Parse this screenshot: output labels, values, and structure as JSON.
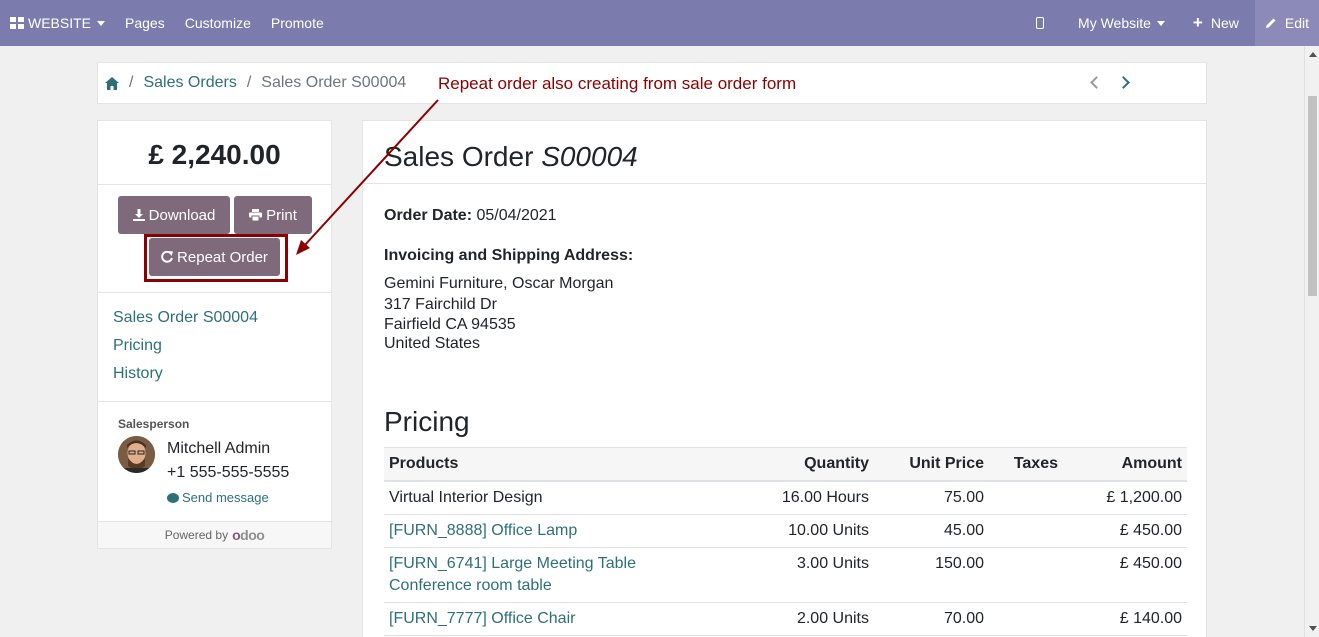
{
  "topbar": {
    "brand": "WEBSITE",
    "menu": [
      "Pages",
      "Customize",
      "Promote"
    ],
    "website": "My Website",
    "new_label": "New",
    "edit_label": "Edit"
  },
  "breadcrumb": {
    "link": "Sales Orders",
    "current": "Sales Order S00004"
  },
  "annotation": "Repeat order also creating from sale order form",
  "sidebar": {
    "total": "£ 2,240.00",
    "download": "Download",
    "print": "Print",
    "repeat": "Repeat Order",
    "nav": [
      "Sales Order S00004",
      "Pricing",
      "History"
    ],
    "salesperson_label": "Salesperson",
    "salesperson_name": "Mitchell Admin",
    "salesperson_phone": "+1 555-555-5555",
    "send_message": "Send message",
    "powered_by": "Powered by",
    "odoo": "odoo"
  },
  "order": {
    "title_prefix": "Sales Order",
    "number": "S00004",
    "date_label": "Order Date:",
    "date": "05/04/2021",
    "address_label": "Invoicing and Shipping Address:",
    "address": [
      "Gemini Furniture, Oscar Morgan",
      "317 Fairchild Dr",
      "Fairfield CA 94535",
      "United States"
    ],
    "pricing_title": "Pricing"
  },
  "table": {
    "headers": [
      "Products",
      "Quantity",
      "Unit Price",
      "Taxes",
      "Amount"
    ],
    "rows": [
      {
        "product": "Virtual Interior Design",
        "desc": "",
        "qty": "16.00 Hours",
        "price": "75.00",
        "taxes": "",
        "amount": "£ 1,200.00",
        "link": false
      },
      {
        "product": "[FURN_8888] Office Lamp",
        "desc": "",
        "qty": "10.00 Units",
        "price": "45.00",
        "taxes": "",
        "amount": "£ 450.00",
        "link": true
      },
      {
        "product": "[FURN_6741] Large Meeting Table",
        "desc": "Conference room table",
        "qty": "3.00 Units",
        "price": "150.00",
        "taxes": "",
        "amount": "£ 450.00",
        "link": true
      },
      {
        "product": "[FURN_7777] Office Chair",
        "desc": "",
        "qty": "2.00 Units",
        "price": "70.00",
        "taxes": "",
        "amount": "£ 140.00",
        "link": true
      }
    ]
  },
  "colors": {
    "topbar": "#7c7bad",
    "link": "#2d7079",
    "button": "#7e6a7b",
    "annotation": "#8b0000"
  }
}
